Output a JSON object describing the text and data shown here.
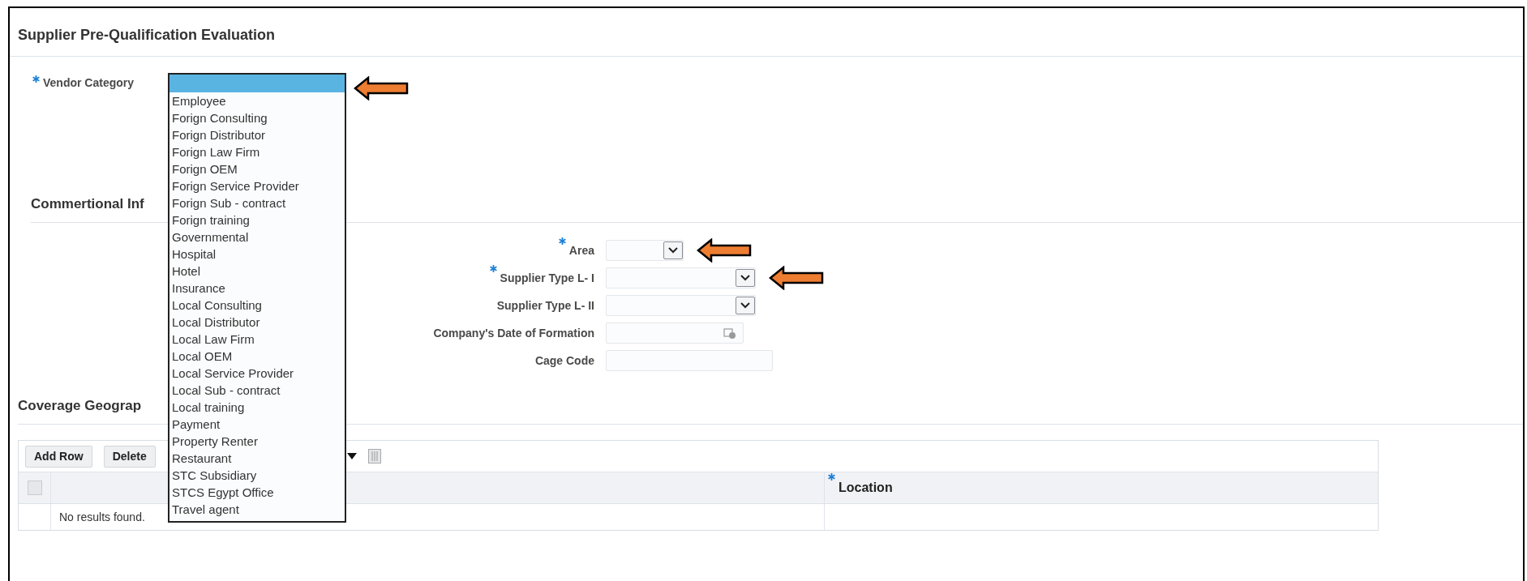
{
  "page": {
    "title": "Supplier Pre-Qualification Evaluation"
  },
  "vendor_category": {
    "label": "Vendor Category",
    "required": true,
    "arrow": true,
    "open": true,
    "options": [
      "Employee",
      "Forign Consulting",
      "Forign Distributor",
      "Forign Law Firm",
      "Forign OEM",
      "Forign Service Provider",
      "Forign Sub - contract",
      "Forign training",
      "Governmental",
      "Hospital",
      "Hotel",
      "Insurance",
      "Local Consulting",
      "Local Distributor",
      "Local Law Firm",
      "Local OEM",
      "Local Service Provider",
      "Local Sub - contract",
      "Local training",
      "Payment",
      "Property Renter",
      "Restaurant",
      "STC Subsidiary",
      "STCS Egypt Office",
      "Travel agent"
    ]
  },
  "commercial_section": {
    "heading": "Commertional Inf",
    "fields": [
      {
        "label": "Area",
        "required": true,
        "kind": "short_select",
        "arrow": true
      },
      {
        "label": "Supplier Type L- I",
        "required": true,
        "kind": "select",
        "arrow": true
      },
      {
        "label": "Supplier Type L- II",
        "required": false,
        "kind": "select",
        "arrow": false
      },
      {
        "label": "Company's Date of Formation",
        "required": false,
        "kind": "date",
        "arrow": false
      },
      {
        "label": "Cage Code",
        "required": false,
        "kind": "text",
        "arrow": false
      }
    ]
  },
  "coverage_section": {
    "heading": "Coverage Geograp",
    "toolbar": [
      {
        "label": "Add Row"
      },
      {
        "label": "Delete"
      }
    ],
    "select_all_checked": false,
    "columns": [
      {
        "label": "Location",
        "required": true
      }
    ],
    "empty_message": "No results found."
  }
}
